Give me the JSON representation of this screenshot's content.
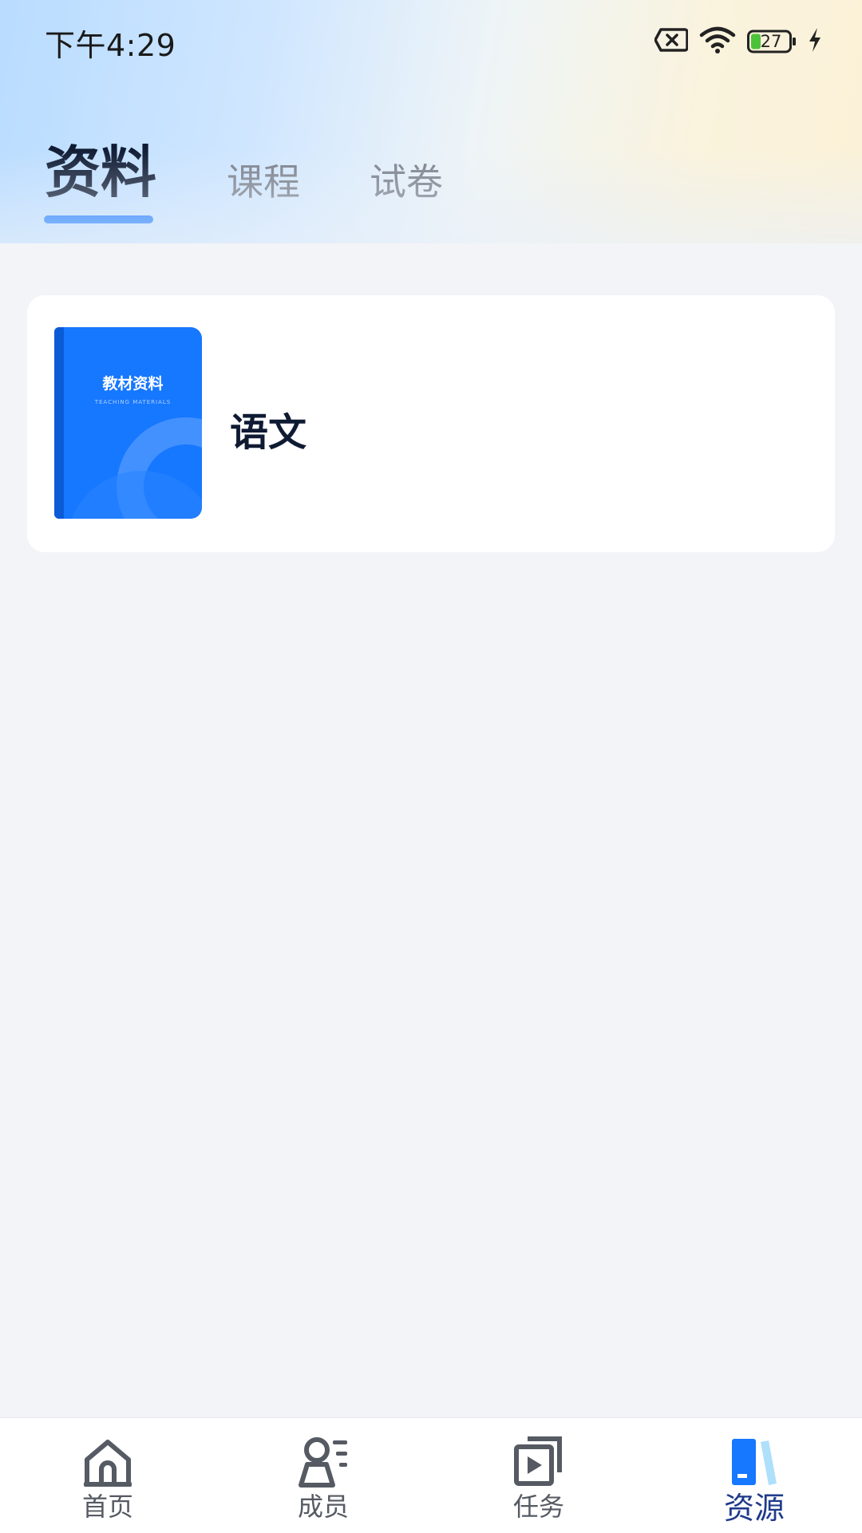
{
  "status_bar": {
    "time": "下午4:29",
    "battery_level": "27"
  },
  "tabs": [
    {
      "label": "资料",
      "active": true
    },
    {
      "label": "课程",
      "active": false
    },
    {
      "label": "试卷",
      "active": false
    }
  ],
  "resources": [
    {
      "cover_title": "教材资料",
      "cover_subtitle": "TEACHING MATERIALS",
      "label": "语文"
    }
  ],
  "bottom_nav": [
    {
      "label": "首页",
      "icon": "home-icon",
      "active": false
    },
    {
      "label": "成员",
      "icon": "members-icon",
      "active": false
    },
    {
      "label": "任务",
      "icon": "task-icon",
      "active": false
    },
    {
      "label": "资源",
      "icon": "resources-icon",
      "active": true
    }
  ],
  "colors": {
    "accent": "#1677ff",
    "active_nav_text": "#1f3a8a",
    "inactive_tab": "#7a7f8a",
    "title_text": "#0f1b33"
  }
}
